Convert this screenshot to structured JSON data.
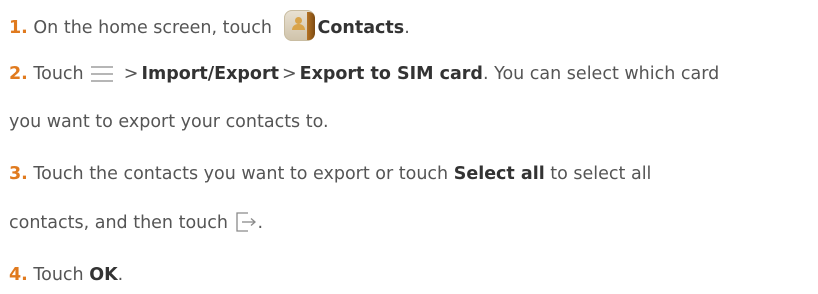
{
  "steps": [
    {
      "number": "1.",
      "before": "On the home screen, touch",
      "icon": "contacts-app-icon",
      "bold": "Contacts",
      "after": "."
    },
    {
      "number": "2.",
      "before": "Touch",
      "icon": "menu-icon",
      "sep": ">",
      "bold1": "Import/Export",
      "bold2": "Export to SIM card",
      "after_line1": ". You can select which card",
      "line2": "you want to export your contacts to."
    },
    {
      "number": "3.",
      "line1_before": "Touch the contacts you want to export or touch",
      "bold": "Select all",
      "line1_after": "to select all",
      "line2_before": "contacts, and then touch",
      "icon": "export-icon",
      "line2_after": "."
    },
    {
      "number": "4.",
      "before": "Touch",
      "bold": "OK",
      "after": "."
    }
  ],
  "colors": {
    "number": "#e07a1e",
    "text": "#555555",
    "bold": "#333333"
  }
}
